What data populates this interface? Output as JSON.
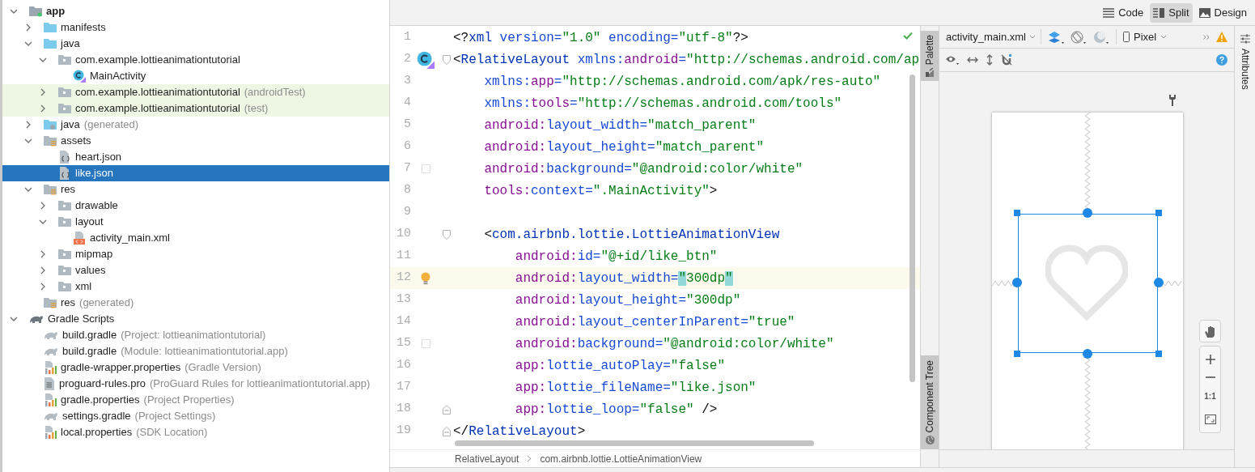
{
  "project_tree": [
    {
      "label": "app",
      "kind": "module",
      "expanded": true,
      "selected": false,
      "test": false,
      "children": [
        {
          "label": "manifests",
          "kind": "source-folder",
          "expanded": false,
          "selected": false,
          "test": false
        },
        {
          "label": "java",
          "kind": "source-folder",
          "expanded": true,
          "selected": false,
          "test": false,
          "children": [
            {
              "label": "com.example.lottieanimationtutorial",
              "kind": "package",
              "expanded": true,
              "selected": false,
              "test": false,
              "children": [
                {
                  "label": "MainActivity",
                  "kind": "class",
                  "selected": false,
                  "test": false
                }
              ]
            },
            {
              "label": "com.example.lottieanimationtutorial",
              "hint": "(androidTest)",
              "kind": "package",
              "expanded": false,
              "selected": false,
              "test": true
            },
            {
              "label": "com.example.lottieanimationtutorial",
              "hint": "(test)",
              "kind": "package",
              "expanded": false,
              "selected": false,
              "test": true
            }
          ]
        },
        {
          "label": "java",
          "hint": "(generated)",
          "kind": "generated-folder",
          "expanded": false,
          "selected": false,
          "test": false
        },
        {
          "label": "assets",
          "kind": "resource-folder",
          "expanded": true,
          "selected": false,
          "test": false,
          "children": [
            {
              "label": "heart.json",
              "kind": "json",
              "selected": false,
              "test": false
            },
            {
              "label": "like.json",
              "kind": "json",
              "selected": true,
              "test": false
            }
          ]
        },
        {
          "label": "res",
          "kind": "resource-folder",
          "expanded": true,
          "selected": false,
          "test": false,
          "children": [
            {
              "label": "drawable",
              "kind": "package",
              "expanded": false,
              "selected": false,
              "test": false
            },
            {
              "label": "layout",
              "kind": "package",
              "expanded": true,
              "selected": false,
              "test": false,
              "children": [
                {
                  "label": "activity_main.xml",
                  "kind": "xml",
                  "selected": false,
                  "test": false
                }
              ]
            },
            {
              "label": "mipmap",
              "kind": "package",
              "expanded": false,
              "selected": false,
              "test": false
            },
            {
              "label": "values",
              "kind": "package",
              "expanded": false,
              "selected": false,
              "test": false
            },
            {
              "label": "xml",
              "kind": "package",
              "expanded": false,
              "selected": false,
              "test": false
            }
          ]
        },
        {
          "label": "res",
          "hint": "(generated)",
          "kind": "resource-folder",
          "selected": false,
          "test": false
        }
      ]
    },
    {
      "label": "Gradle Scripts",
      "kind": "gradle-root",
      "expanded": true,
      "selected": false,
      "test": false,
      "children": [
        {
          "label": "build.gradle",
          "hint": "(Project: lottieanimationtutorial)",
          "kind": "gradle",
          "selected": false,
          "test": false
        },
        {
          "label": "build.gradle",
          "hint": "(Module: lottieanimationtutorial.app)",
          "kind": "gradle",
          "selected": false,
          "test": false
        },
        {
          "label": "gradle-wrapper.properties",
          "hint": "(Gradle Version)",
          "kind": "properties",
          "selected": false,
          "test": false
        },
        {
          "label": "proguard-rules.pro",
          "hint": "(ProGuard Rules for lottieanimationtutorial.app)",
          "kind": "text",
          "selected": false,
          "test": false
        },
        {
          "label": "gradle.properties",
          "hint": "(Project Properties)",
          "kind": "properties",
          "selected": false,
          "test": false
        },
        {
          "label": "settings.gradle",
          "hint": "(Project Settings)",
          "kind": "gradle",
          "selected": false,
          "test": false
        },
        {
          "label": "local.properties",
          "hint": "(SDK Location)",
          "kind": "properties",
          "selected": false,
          "test": false
        }
      ]
    }
  ],
  "view_modes": [
    {
      "label": "Code",
      "selected": false
    },
    {
      "label": "Split",
      "selected": true
    },
    {
      "label": "Design",
      "selected": false
    }
  ],
  "editor": {
    "inspection_passed": true,
    "lines": [
      {
        "number": "1",
        "current": false,
        "tokens": [
          {
            "text": "<?",
            "kind": "p"
          },
          {
            "text": "xml",
            "kind": "tag"
          },
          {
            "text": " version=",
            "kind": "attr"
          },
          {
            "text": "\"1.0\"",
            "kind": "val"
          },
          {
            "text": " encoding=",
            "kind": "attr"
          },
          {
            "text": "\"utf-8\"",
            "kind": "val"
          },
          {
            "text": "?>",
            "kind": "p"
          }
        ]
      },
      {
        "number": "2",
        "current": false,
        "gutter_icon": {
          "kind": "class"
        },
        "fold": {
          "kind": "start"
        },
        "tokens": [
          {
            "text": "<",
            "kind": "p"
          },
          {
            "text": "RelativeLayout",
            "kind": "tag"
          },
          {
            "text": " xmlns:",
            "kind": "attr"
          },
          {
            "text": "android",
            "kind": "ns"
          },
          {
            "text": "=",
            "kind": "attr"
          },
          {
            "text": "\"http://schemas.android.com/ap",
            "kind": "val"
          }
        ]
      },
      {
        "number": "3",
        "current": false,
        "tokens": [
          {
            "text": "    xmlns:",
            "kind": "attr"
          },
          {
            "text": "app",
            "kind": "ns"
          },
          {
            "text": "=",
            "kind": "attr"
          },
          {
            "text": "\"http://schemas.android.com/apk/res-auto\"",
            "kind": "val"
          }
        ]
      },
      {
        "number": "4",
        "current": false,
        "tokens": [
          {
            "text": "    xmlns:",
            "kind": "attr"
          },
          {
            "text": "tools",
            "kind": "ns"
          },
          {
            "text": "=",
            "kind": "attr"
          },
          {
            "text": "\"http://schemas.android.com/tools\"",
            "kind": "val"
          }
        ]
      },
      {
        "number": "5",
        "current": false,
        "tokens": [
          {
            "text": "    android:",
            "kind": "ns"
          },
          {
            "text": "layout_width=",
            "kind": "attr"
          },
          {
            "text": "\"match_parent\"",
            "kind": "val"
          }
        ]
      },
      {
        "number": "6",
        "current": false,
        "tokens": [
          {
            "text": "    android:",
            "kind": "ns"
          },
          {
            "text": "layout_height=",
            "kind": "attr"
          },
          {
            "text": "\"match_parent\"",
            "kind": "val"
          }
        ]
      },
      {
        "number": "7",
        "current": false,
        "gutter_icon": {
          "kind": "swatch",
          "color": "#ffffff"
        },
        "tokens": [
          {
            "text": "    android:",
            "kind": "ns"
          },
          {
            "text": "background=",
            "kind": "attr"
          },
          {
            "text": "\"@android:color/white\"",
            "kind": "val"
          }
        ]
      },
      {
        "number": "8",
        "current": false,
        "tokens": [
          {
            "text": "    tools:",
            "kind": "ns"
          },
          {
            "text": "context=",
            "kind": "attr"
          },
          {
            "text": "\".MainActivity\"",
            "kind": "val"
          },
          {
            "text": ">",
            "kind": "p"
          }
        ]
      },
      {
        "number": "9",
        "current": false
      },
      {
        "number": "10",
        "current": false,
        "fold": {
          "kind": "start"
        },
        "tokens": [
          {
            "text": "    <",
            "kind": "p"
          },
          {
            "text": "com.airbnb.lottie.LottieAnimationView",
            "kind": "tag"
          }
        ]
      },
      {
        "number": "11",
        "current": false,
        "tokens": [
          {
            "text": "        android:",
            "kind": "ns"
          },
          {
            "text": "id=",
            "kind": "attr"
          },
          {
            "text": "\"@+id/like_btn\"",
            "kind": "val"
          }
        ]
      },
      {
        "number": "12",
        "current": true,
        "gutter_icon": {
          "kind": "bulb"
        },
        "tokens": [
          {
            "text": "        android:",
            "kind": "ns"
          },
          {
            "text": "layout_width=",
            "kind": "attr"
          },
          {
            "text": "\"",
            "kind": "match"
          },
          {
            "text": "300dp",
            "kind": "val"
          },
          {
            "text": "\"",
            "kind": "match"
          }
        ]
      },
      {
        "number": "13",
        "current": false,
        "tokens": [
          {
            "text": "        android:",
            "kind": "ns"
          },
          {
            "text": "layout_height=",
            "kind": "attr"
          },
          {
            "text": "\"300dp\"",
            "kind": "val"
          }
        ]
      },
      {
        "number": "14",
        "current": false,
        "tokens": [
          {
            "text": "        android:",
            "kind": "ns"
          },
          {
            "text": "layout_centerInParent=",
            "kind": "attr"
          },
          {
            "text": "\"true\"",
            "kind": "val"
          }
        ]
      },
      {
        "number": "15",
        "current": false,
        "gutter_icon": {
          "kind": "swatch",
          "color": "#ffffff"
        },
        "tokens": [
          {
            "text": "        android:",
            "kind": "ns"
          },
          {
            "text": "background=",
            "kind": "attr"
          },
          {
            "text": "\"@android:color/white\"",
            "kind": "val"
          }
        ]
      },
      {
        "number": "16",
        "current": false,
        "tokens": [
          {
            "text": "        app:",
            "kind": "ns"
          },
          {
            "text": "lottie_autoPlay=",
            "kind": "attr"
          },
          {
            "text": "\"false\"",
            "kind": "val"
          }
        ]
      },
      {
        "number": "17",
        "current": false,
        "tokens": [
          {
            "text": "        app:",
            "kind": "ns"
          },
          {
            "text": "lottie_fileName=",
            "kind": "attr"
          },
          {
            "text": "\"like.json\"",
            "kind": "val"
          }
        ]
      },
      {
        "number": "18",
        "current": false,
        "fold": {
          "kind": "end"
        },
        "tokens": [
          {
            "text": "        app:",
            "kind": "ns"
          },
          {
            "text": "lottie_loop=",
            "kind": "attr"
          },
          {
            "text": "\"false\"",
            "kind": "val"
          },
          {
            "text": " />",
            "kind": "p"
          }
        ]
      },
      {
        "number": "19",
        "current": false,
        "fold": {
          "kind": "end"
        },
        "tokens": [
          {
            "text": "</",
            "kind": "p"
          },
          {
            "text": "RelativeLayout",
            "kind": "tag"
          },
          {
            "text": ">",
            "kind": "p"
          }
        ]
      }
    ]
  },
  "breadcrumbs": [
    "RelativeLayout",
    "com.airbnb.lottie.LottieAnimationView"
  ],
  "side_tabs": {
    "palette": "Palette",
    "component_tree": "Component Tree",
    "attributes": "Attributes"
  },
  "design": {
    "file": "activity_main.xml",
    "device": "Pixel",
    "zoom_actual": "1:1"
  }
}
